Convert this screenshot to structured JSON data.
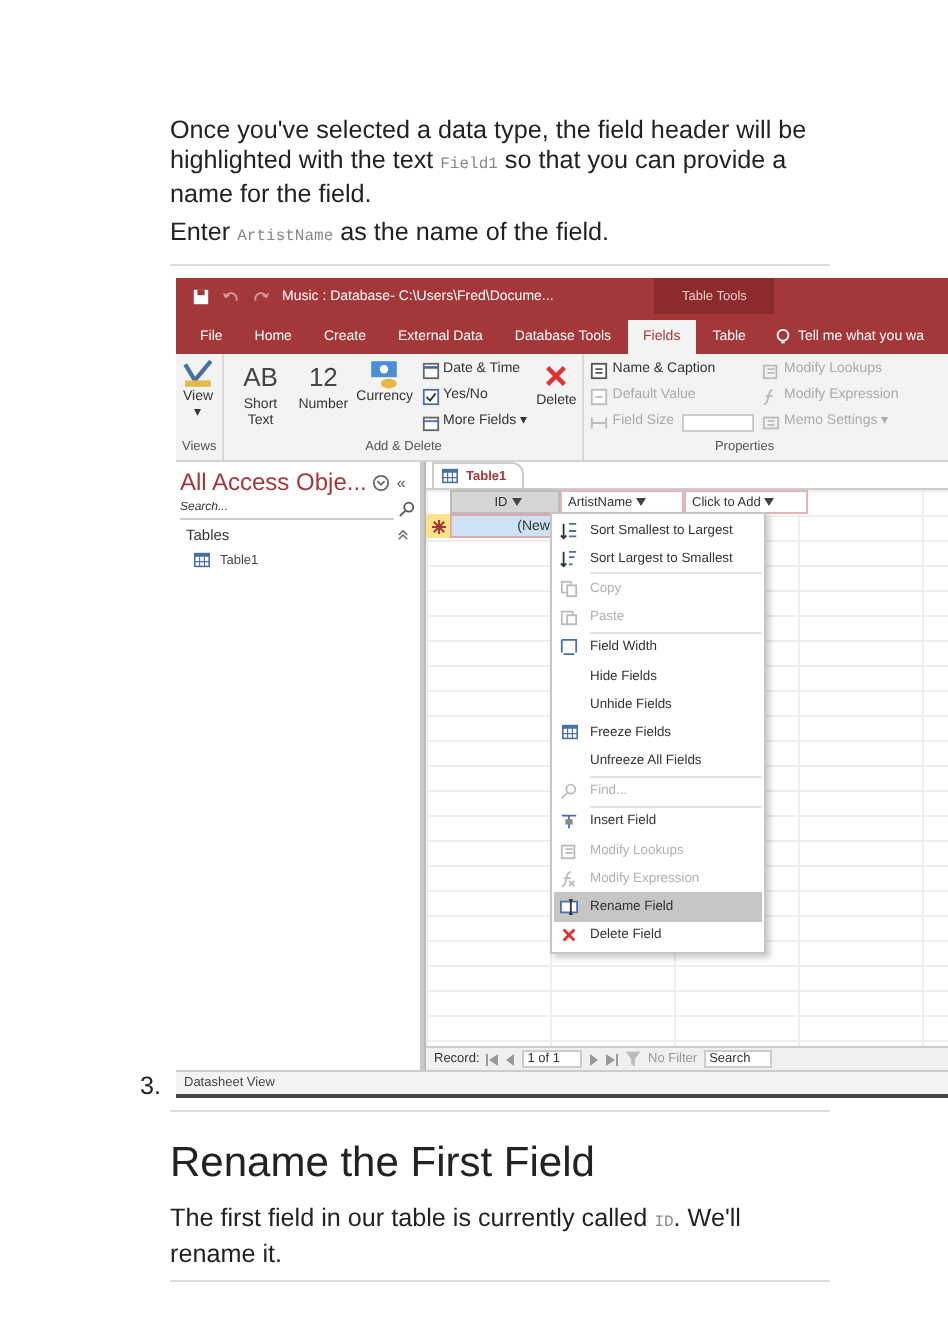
{
  "intro": [
    [
      {
        "kind": "text",
        "text": "Once you've selected a data type, the field header will be highlighted with the text "
      },
      {
        "kind": "code",
        "text": "Field1"
      },
      {
        "kind": "text",
        "text": " so that you can provide a name for the field."
      }
    ],
    [
      {
        "kind": "text",
        "text": "Enter "
      },
      {
        "kind": "code",
        "text": "ArtistName"
      },
      {
        "kind": "text",
        "text": " as the name of the field."
      }
    ]
  ],
  "step_number": "3.",
  "window": {
    "title": "Music : Database- C:\\Users\\Fred\\Docume...",
    "context_tab": "Table Tools"
  },
  "tabs": [
    {
      "label": "File",
      "selected": false
    },
    {
      "label": "Home",
      "selected": false
    },
    {
      "label": "Create",
      "selected": false
    },
    {
      "label": "External Data",
      "selected": false
    },
    {
      "label": "Database Tools",
      "selected": false
    },
    {
      "label": "Fields",
      "selected": true
    },
    {
      "label": "Table",
      "selected": false
    }
  ],
  "tell_me": "Tell me what you wa",
  "ribbon": {
    "view": {
      "label": "View",
      "caret": "▾"
    },
    "big_buttons": [
      {
        "glyph": "AB",
        "label": "Short Text"
      },
      {
        "glyph": "12",
        "label": "Number"
      },
      {
        "label": "Currency"
      }
    ],
    "small_buttons": [
      {
        "label": "Date & Time"
      },
      {
        "label": "Yes/No"
      },
      {
        "label": "More Fields ▾"
      }
    ],
    "delete": {
      "label": "Delete"
    },
    "properties_1": [
      {
        "label": "Name & Caption",
        "disabled": false
      },
      {
        "label": "Default Value",
        "disabled": true
      },
      {
        "label": "Field Size",
        "disabled": true
      }
    ],
    "properties_2": [
      {
        "label": "Modify Lookups",
        "disabled": true
      },
      {
        "label": "Modify Expression",
        "disabled": true
      },
      {
        "label": "Memo Settings ▾",
        "disabled": true
      }
    ],
    "groups": [
      "Views",
      "Add & Delete",
      "Properties"
    ]
  },
  "nav_pane": {
    "title": "All Access Obje...",
    "collapse": "«",
    "search_placeholder": "Search...",
    "section": "Tables",
    "items": [
      "Table1"
    ]
  },
  "datasheet": {
    "tab": "Table1",
    "columns": [
      "ID",
      "ArtistName",
      "Click to Add"
    ],
    "new_row": "(New"
  },
  "context_menu": [
    [
      {
        "label": "Sort Smallest to Largest",
        "disabled": false,
        "selected": false
      },
      {
        "label": "Sort Largest to Smallest",
        "disabled": false,
        "selected": false
      }
    ],
    [
      {
        "label": "Copy",
        "disabled": true,
        "selected": false
      },
      {
        "label": "Paste",
        "disabled": true,
        "selected": false
      }
    ],
    [
      {
        "label": "Field Width",
        "disabled": false,
        "selected": false
      },
      {
        "label": "Hide Fields",
        "disabled": false,
        "selected": false
      },
      {
        "label": "Unhide Fields",
        "disabled": false,
        "selected": false
      },
      {
        "label": "Freeze Fields",
        "disabled": false,
        "selected": false
      },
      {
        "label": "Unfreeze All Fields",
        "disabled": false,
        "selected": false
      }
    ],
    [
      {
        "label": "Find...",
        "disabled": true,
        "selected": false
      }
    ],
    [
      {
        "label": "Insert Field",
        "disabled": false,
        "selected": false
      },
      {
        "label": "Modify Lookups",
        "disabled": true,
        "selected": false
      },
      {
        "label": "Modify Expression",
        "disabled": true,
        "selected": false
      },
      {
        "label": "Rename Field",
        "disabled": false,
        "selected": true
      },
      {
        "label": "Delete Field",
        "disabled": false,
        "selected": false
      }
    ]
  ],
  "record_bar": {
    "label": "Record:",
    "position": "1 of 1",
    "filter": "No Filter",
    "search": "Search"
  },
  "status_bar": "Datasheet View",
  "heading": "Rename the First Field",
  "outro": [
    {
      "kind": "text",
      "text": "The first field in our table is currently called "
    },
    {
      "kind": "code",
      "text": "ID"
    },
    {
      "kind": "text",
      "text": ". We'll rename it."
    }
  ]
}
